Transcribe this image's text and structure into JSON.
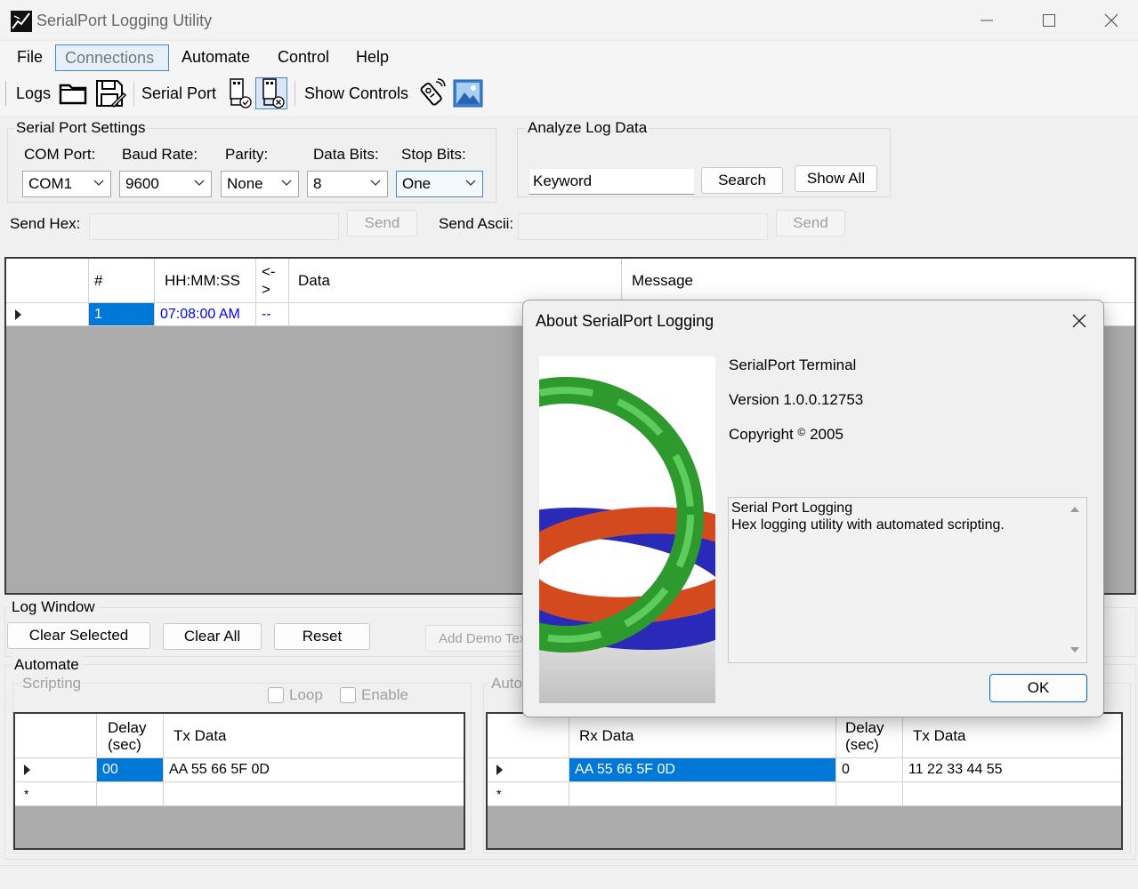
{
  "app": {
    "title": "SerialPort Logging Utility"
  },
  "menu": {
    "items": [
      "File",
      "Connections",
      "Automate",
      "Control",
      "Help"
    ]
  },
  "toolbar": {
    "logs_label": "Logs",
    "serial_port_label": "Serial Port",
    "show_controls_label": "Show Controls"
  },
  "settings": {
    "group_title": "Serial Port Settings",
    "com_port_label": "COM Port:",
    "com_port_value": "COM1",
    "baud_rate_label": "Baud Rate:",
    "baud_rate_value": "9600",
    "parity_label": "Parity:",
    "parity_value": "None",
    "data_bits_label": "Data Bits:",
    "data_bits_value": "8",
    "stop_bits_label": "Stop Bits:",
    "stop_bits_value": "One"
  },
  "analyze": {
    "group_title": "Analyze Log Data",
    "keyword_value": "Keyword",
    "search_label": "Search",
    "show_all_label": "Show All"
  },
  "send": {
    "hex_label": "Send Hex:",
    "ascii_label": "Send Ascii:",
    "send_label": "Send"
  },
  "log_grid": {
    "columns": [
      "#",
      "HH:MM:SS",
      "<->",
      "Data",
      "Message"
    ],
    "rows": [
      {
        "num": "1",
        "time": "07:08:00 AM",
        "dir": "--",
        "data": "",
        "message": ""
      }
    ]
  },
  "log_window": {
    "group_title": "Log Window",
    "clear_selected_label": "Clear Selected",
    "clear_all_label": "Clear All",
    "reset_label": "Reset",
    "add_demo_label": "Add Demo Tex"
  },
  "automate": {
    "group_title": "Automate",
    "scripting_title": "Scripting",
    "loop_label": "Loop",
    "enable_label": "Enable",
    "auto_partial_title": "Auto",
    "script_grid": {
      "columns": [
        "Delay",
        "(sec)",
        "Tx Data"
      ],
      "rows": [
        {
          "delay": "00",
          "tx": "AA 55 66 5F 0D"
        }
      ]
    },
    "response_grid": {
      "columns": [
        "Rx Data",
        "Delay",
        "(sec)",
        "Tx Data"
      ],
      "rows": [
        {
          "rx": "AA 55 66 5F 0D",
          "delay": "0",
          "tx": "11 22 33 44 55"
        }
      ]
    }
  },
  "about_dialog": {
    "title": "About SerialPort Logging",
    "product": "SerialPort Terminal",
    "version": "Version 1.0.0.12753",
    "copyright_label": "Copyright",
    "copyright_year": "2005",
    "description_line1": "Serial Port Logging",
    "description_line2": "Hex logging utility with automated scripting.",
    "ok_label": "OK"
  },
  "colors": {
    "selection": "#0078d7",
    "accent_border": "#4a86c5",
    "time_text": "#0000ff"
  }
}
